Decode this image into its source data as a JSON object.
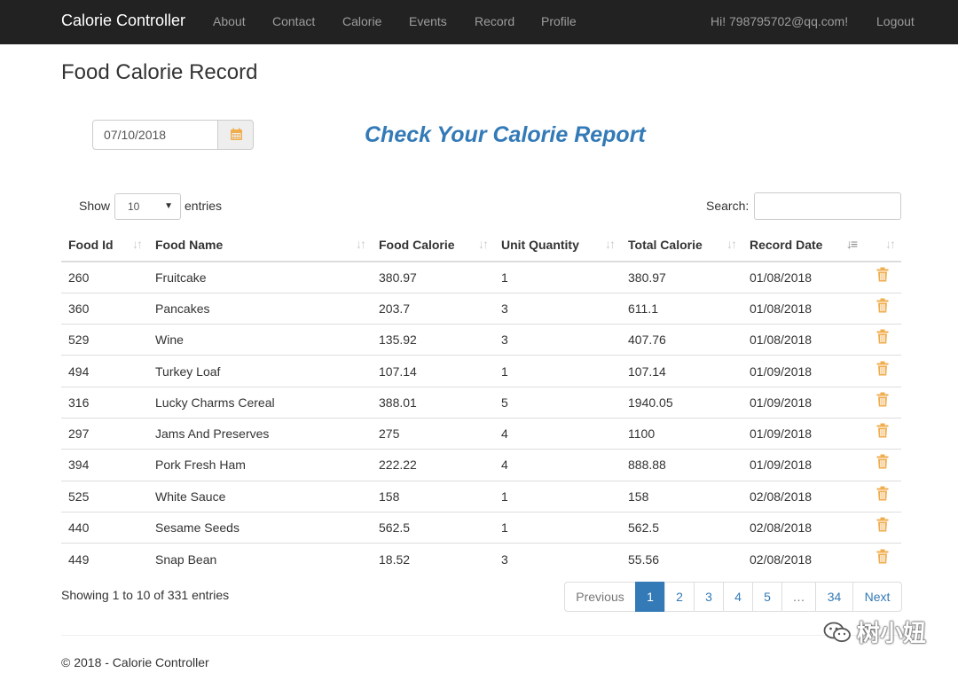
{
  "navbar": {
    "brand": "Calorie Controller",
    "links": [
      "About",
      "Contact",
      "Calorie",
      "Events",
      "Record",
      "Profile"
    ],
    "greeting": "Hi! 798795702@qq.com!",
    "logout": "Logout"
  },
  "page": {
    "title": "Food Calorie Record",
    "date_value": "07/10/2018",
    "report_heading": "Check Your Calorie Report"
  },
  "controls": {
    "show_label": "Show",
    "entries_value": "10",
    "entries_label": "entries",
    "search_label": "Search:",
    "search_value": ""
  },
  "table": {
    "headers": [
      "Food Id",
      "Food Name",
      "Food Calorie",
      "Unit Quantity",
      "Total Calorie",
      "Record Date"
    ],
    "sorted_column": "Record Date",
    "rows": [
      {
        "id": "260",
        "name": "Fruitcake",
        "calorie": "380.97",
        "qty": "1",
        "total": "380.97",
        "date": "01/08/2018"
      },
      {
        "id": "360",
        "name": "Pancakes",
        "calorie": "203.7",
        "qty": "3",
        "total": "611.1",
        "date": "01/08/2018"
      },
      {
        "id": "529",
        "name": "Wine",
        "calorie": "135.92",
        "qty": "3",
        "total": "407.76",
        "date": "01/08/2018"
      },
      {
        "id": "494",
        "name": "Turkey Loaf",
        "calorie": "107.14",
        "qty": "1",
        "total": "107.14",
        "date": "01/09/2018"
      },
      {
        "id": "316",
        "name": "Lucky Charms Cereal",
        "calorie": "388.01",
        "qty": "5",
        "total": "1940.05",
        "date": "01/09/2018"
      },
      {
        "id": "297",
        "name": "Jams And Preserves",
        "calorie": "275",
        "qty": "4",
        "total": "1100",
        "date": "01/09/2018"
      },
      {
        "id": "394",
        "name": "Pork Fresh Ham",
        "calorie": "222.22",
        "qty": "4",
        "total": "888.88",
        "date": "01/09/2018"
      },
      {
        "id": "525",
        "name": "White Sauce",
        "calorie": "158",
        "qty": "1",
        "total": "158",
        "date": "02/08/2018"
      },
      {
        "id": "440",
        "name": "Sesame Seeds",
        "calorie": "562.5",
        "qty": "1",
        "total": "562.5",
        "date": "02/08/2018"
      },
      {
        "id": "449",
        "name": "Snap Bean",
        "calorie": "18.52",
        "qty": "3",
        "total": "55.56",
        "date": "02/08/2018"
      }
    ]
  },
  "pagination": {
    "info": "Showing 1 to 10 of 331 entries",
    "previous": "Previous",
    "pages": [
      "1",
      "2",
      "3",
      "4",
      "5",
      "…",
      "34"
    ],
    "current": "1",
    "next": "Next"
  },
  "footer": {
    "copyright": "© 2018 - Calorie Controller"
  },
  "watermark": {
    "text": "树小妞"
  },
  "colors": {
    "navbar_bg": "#222222",
    "accent": "#337ab7",
    "trash": "#f0ad4e"
  }
}
